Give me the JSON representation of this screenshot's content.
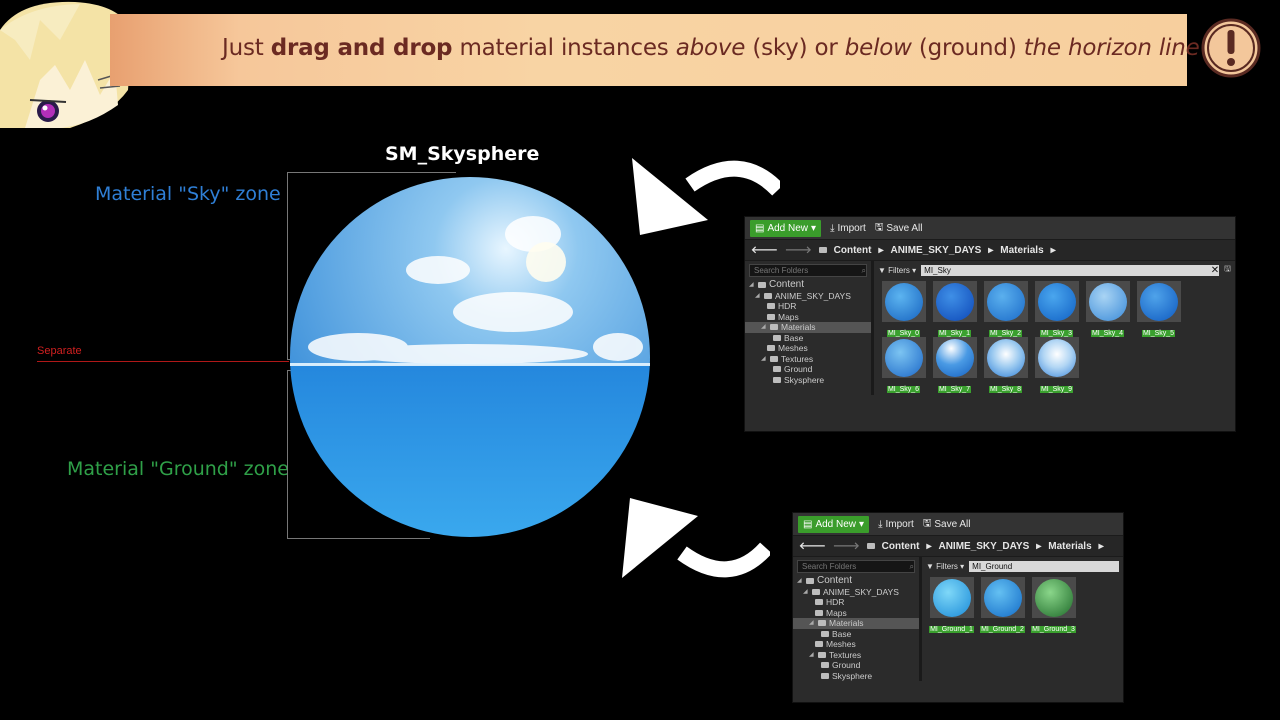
{
  "banner": {
    "p1": "Just ",
    "b1": "drag and drop",
    "p2": " material instances ",
    "i1": "above",
    "p3": " (sky) or ",
    "i2": "below",
    "p4": " (ground) ",
    "i3": "the horizon line"
  },
  "icons": {
    "alert": "exclamation-icon",
    "mascot": "anime-character-icon",
    "arrow": "curved-arrow-icon",
    "folder": "folder-icon",
    "search": "search-icon",
    "back": "back-arrow-icon",
    "save": "save-icon",
    "import": "import-icon"
  },
  "diagram": {
    "title": "SM_Skysphere",
    "sky_zone": "Material \"Sky\" zone",
    "ground_zone": "Material \"Ground\" zone",
    "separate": "Separate"
  },
  "colors": {
    "sky_label": "#2f7fd6",
    "ground_label": "#2fa048",
    "separate": "#d02020",
    "add_new": "#3a9d2b",
    "banner_text": "#6b2a22"
  },
  "browser_sky": {
    "add_new": "Add New",
    "import": "Import",
    "save_all": "Save All",
    "path": [
      "Content",
      "ANIME_SKY_DAYS",
      "Materials"
    ],
    "search_placeholder": "Search Folders",
    "filters": "Filters",
    "filter_value": "MI_Sky",
    "tree": [
      "Content",
      "ANIME_SKY_DAYS",
      "HDR",
      "Maps",
      "Materials",
      "Base",
      "Meshes",
      "Textures",
      "Ground",
      "Skysphere"
    ],
    "assets": [
      "MI_Sky_0",
      "MI_Sky_1",
      "MI_Sky_2",
      "MI_Sky_3",
      "MI_Sky_4",
      "MI_Sky_5",
      "MI_Sky_6",
      "MI_Sky_7",
      "MI_Sky_8",
      "MI_Sky_9"
    ]
  },
  "browser_ground": {
    "add_new": "Add New",
    "import": "Import",
    "save_all": "Save All",
    "path": [
      "Content",
      "ANIME_SKY_DAYS",
      "Materials"
    ],
    "search_placeholder": "Search Folders",
    "filters": "Filters",
    "filter_value": "MI_Ground",
    "tree": [
      "Content",
      "ANIME_SKY_DAYS",
      "HDR",
      "Maps",
      "Materials",
      "Base",
      "Meshes",
      "Textures",
      "Ground",
      "Skysphere"
    ],
    "assets": [
      "MI_Ground_1",
      "MI_Ground_2",
      "MI_Ground_3"
    ]
  }
}
